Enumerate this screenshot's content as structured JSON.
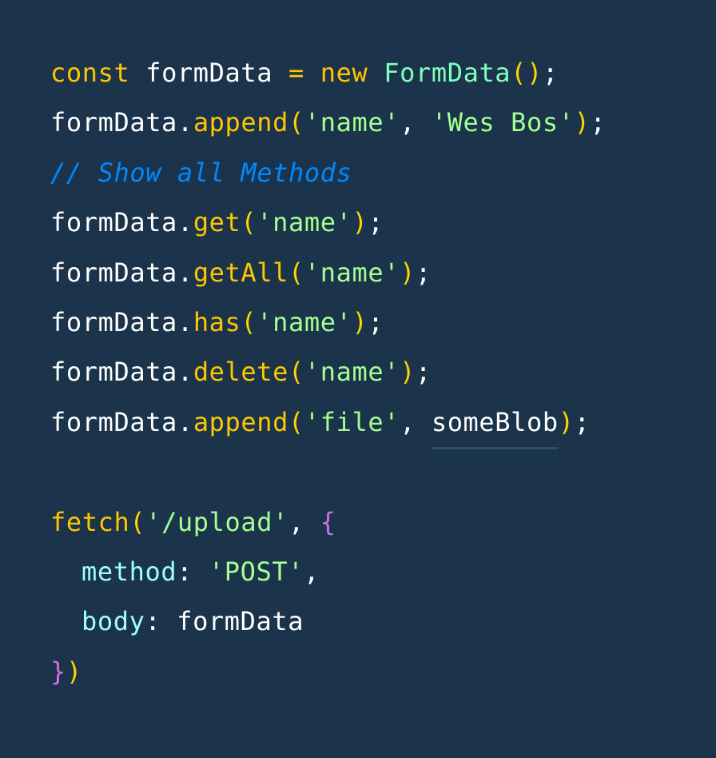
{
  "code": {
    "l1": {
      "kw_const": "const",
      "var": "formData",
      "op": "=",
      "kw_new": "new",
      "cls": "FormData",
      "paren_open": "(",
      "paren_close": ")",
      "semi": ";"
    },
    "l2": {
      "obj": "formData",
      "dot": ".",
      "method": "append",
      "p_open": "(",
      "arg1": "'name'",
      "comma": ", ",
      "arg2": "'Wes Bos'",
      "p_close": ")",
      "semi": ";"
    },
    "l3": {
      "comment": "// Show all Methods"
    },
    "l4": {
      "obj": "formData",
      "dot": ".",
      "method": "get",
      "p_open": "(",
      "arg": "'name'",
      "p_close": ")",
      "semi": ";"
    },
    "l5": {
      "obj": "formData",
      "dot": ".",
      "method": "getAll",
      "p_open": "(",
      "arg": "'name'",
      "p_close": ")",
      "semi": ";"
    },
    "l6": {
      "obj": "formData",
      "dot": ".",
      "method": "has",
      "p_open": "(",
      "arg": "'name'",
      "p_close": ")",
      "semi": ";"
    },
    "l7": {
      "obj": "formData",
      "dot": ".",
      "method": "delete",
      "p_open": "(",
      "arg": "'name'",
      "p_close": ")",
      "semi": ";"
    },
    "l8": {
      "obj": "formData",
      "dot": ".",
      "method": "append",
      "p_open": "(",
      "arg1": "'file'",
      "comma": ", ",
      "arg2": "someBlob",
      "p_close": ")",
      "semi": ";"
    },
    "l10": {
      "fn": "fetch",
      "p_open": "(",
      "arg": "'/upload'",
      "comma": ", ",
      "brace_open": "{"
    },
    "l11": {
      "key": "method",
      "colon": ": ",
      "value": "'POST'",
      "comma": ","
    },
    "l12": {
      "key": "body",
      "colon": ": ",
      "value": "formData"
    },
    "l13": {
      "brace_close": "}",
      "p_close": ")"
    }
  },
  "colors": {
    "background": "#1b344b",
    "keyword": "#ffc600",
    "class_name": "#80ffbb",
    "string": "#a5ff90",
    "comment": "#0088ff",
    "property": "#9effff",
    "brace": "#d36ce6",
    "identifier": "#ffffff"
  }
}
